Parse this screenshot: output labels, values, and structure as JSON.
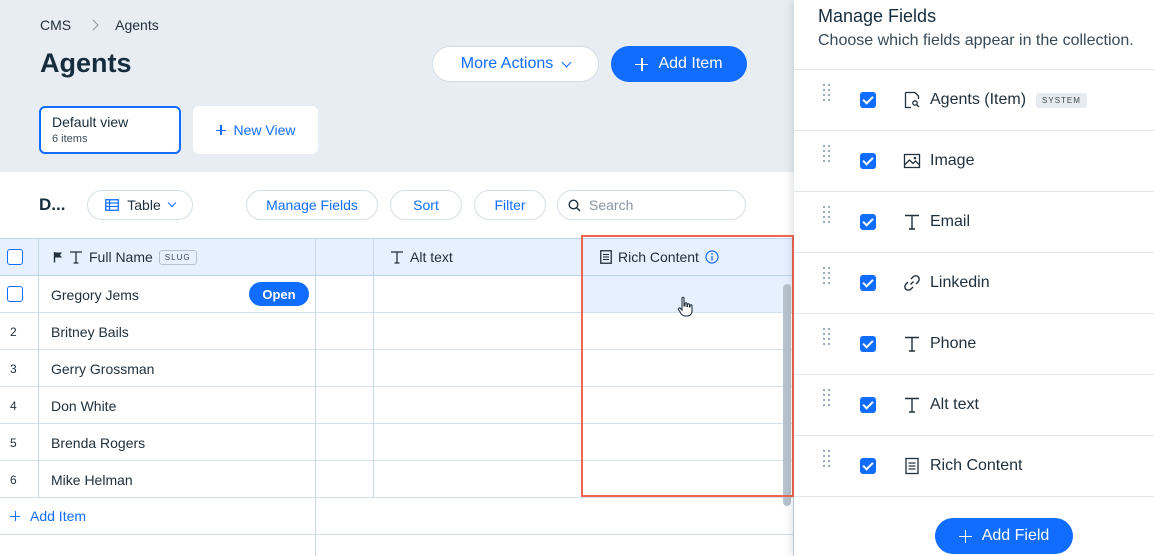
{
  "breadcrumb": {
    "root": "CMS",
    "current": "Agents"
  },
  "page": {
    "title": "Agents"
  },
  "actions": {
    "more_actions": "More Actions",
    "add_item": "Add Item"
  },
  "views": {
    "default_title": "Default view",
    "default_count": "6 items",
    "new_view": "New View"
  },
  "toolbar": {
    "title": "D...",
    "view_type": "Table",
    "manage_fields": "Manage Fields",
    "sort": "Sort",
    "filter": "Filter",
    "search_placeholder": "Search"
  },
  "table": {
    "columns": [
      {
        "label": "Full Name",
        "badge": "SLUG"
      },
      {
        "label": ""
      },
      {
        "label": "Alt text"
      },
      {
        "label": "Rich Content"
      }
    ],
    "rows": [
      {
        "num": "",
        "name": "Gregory Jems"
      },
      {
        "num": "2",
        "name": "Britney Bails"
      },
      {
        "num": "3",
        "name": "Gerry Grossman"
      },
      {
        "num": "4",
        "name": "Don White"
      },
      {
        "num": "5",
        "name": "Brenda Rogers"
      },
      {
        "num": "6",
        "name": "Mike Helman"
      }
    ],
    "open_label": "Open",
    "add_item": "Add Item"
  },
  "panel": {
    "title": "Manage Fields",
    "subtitle": "Choose which fields appear in the collection.",
    "fields": [
      {
        "label": "Agents (Item)",
        "badge": "SYSTEM",
        "icon": "item-icon"
      },
      {
        "label": "Image",
        "icon": "image-icon"
      },
      {
        "label": "Email",
        "icon": "text-icon"
      },
      {
        "label": "Linkedin",
        "icon": "link-icon"
      },
      {
        "label": "Phone",
        "icon": "text-icon"
      },
      {
        "label": "Alt text",
        "icon": "text-icon"
      },
      {
        "label": "Rich Content",
        "icon": "document-icon"
      }
    ],
    "add_field": "Add Field"
  },
  "colors": {
    "accent": "#116dff",
    "highlight": "#ee6650",
    "header_bg": "#e8edf3"
  }
}
